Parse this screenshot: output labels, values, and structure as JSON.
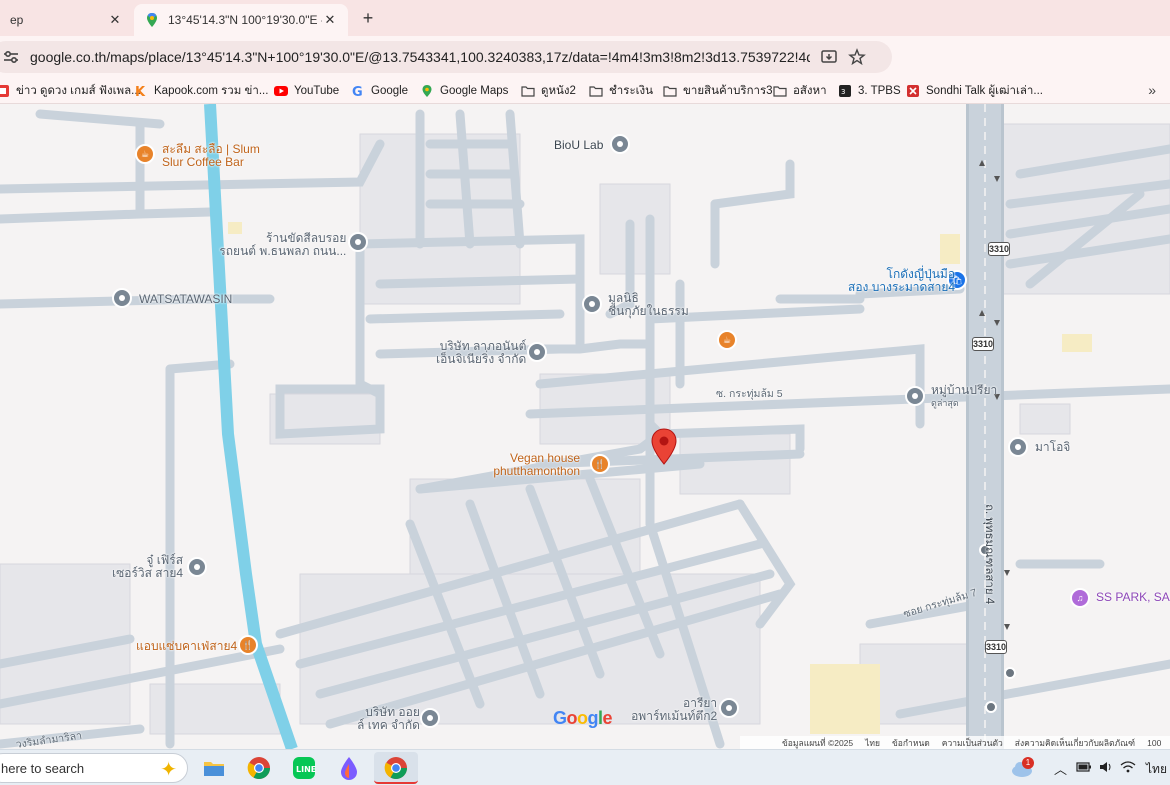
{
  "tabs": [
    {
      "title": "ep",
      "active": false
    },
    {
      "title": "13°45'14.3\"N 100°19'30.0\"E - G",
      "active": true
    }
  ],
  "omnibox": {
    "url": "google.co.th/maps/place/13°45'14.3\"N+100°19'30.0\"E/@13.7543341,100.3240383,17z/data=!4m4!3m3!8m2!3d13.7539722!4d100.325?entry..."
  },
  "bookmarks": [
    "ข่าว ดูดวง เกมส์ ฟังเพล...",
    "Kapook.com รวม ข่า...",
    "YouTube",
    "Google",
    "Google Maps",
    "ดูหนัง2",
    "ชำระเงิน",
    "ขายสินค้าบริการ3",
    "อสังหา",
    "3. TPBS",
    "Sondhi Talk ผู้เฒ่าเล่า..."
  ],
  "map": {
    "labels": {
      "slum_slur_1": "สะลึม สะลือ | Slum",
      "slum_slur_2": "Slur Coffee Bar",
      "biou": "BioU Lab",
      "raan_1": "ร้านขัดสีลบรอย",
      "raan_2": "รถยนต์ พ.ธนพลภ ถนน...",
      "watsatawasin": "WATSATAWASIN",
      "mulanithi_1": "มูลนิธิ",
      "mulanithi_2": "ชีนกุภัยในธรรม",
      "bosat_1": "บริษัท ลาภอนันต์",
      "bosat_2": "เอ็นจิเนียริ่ง จำกัด",
      "soi5": "ซ. กระทุ่มล้ม 5",
      "moo_1": "หมู่บ้านปรียา",
      "moo_2": "ดูล่าสุด",
      "vegan_1": "Vegan house",
      "vegan_2": "phutthamonthon",
      "kodang_1": "โกดังญี่ปุ่นมือ",
      "kodang_2": "สอง บางระมาดสาย4",
      "maoji": "มาโอจิ",
      "road_name": "ถ. พุทธมณฑลสาย 4",
      "ju_1": "จู๋ เฟิร์ส",
      "ju_2": "เซอร์วิส สาย4",
      "aeb": "แอบแซ่บคาเฟ่สาย4",
      "ss_park": "SS PARK, SA",
      "soi7": "ซอย กระทุ่มล้ม 7",
      "bosat_oil_1": "บริษัท ออย",
      "bosat_oil_2": "ล์ เทค จำกัด",
      "ariya_1": "อารียา",
      "ariya_2": "อพาร์ทเม้นท์ตึก2",
      "shield": "3310",
      "bottom_left_road": "วงริมลำมาริลา"
    },
    "google_logo": "Google",
    "footer": [
      "ข้อมูลแผนที่ ©2025",
      "ไทย",
      "ข้อกำหนด",
      "ความเป็นส่วนตัว",
      "ส่งความคิดเห็นเกี่ยวกับผลิตภัณฑ์",
      "100"
    ]
  },
  "taskbar": {
    "search_text": "here to search",
    "tray_lang": "ไทย",
    "tray_badge": "1"
  }
}
